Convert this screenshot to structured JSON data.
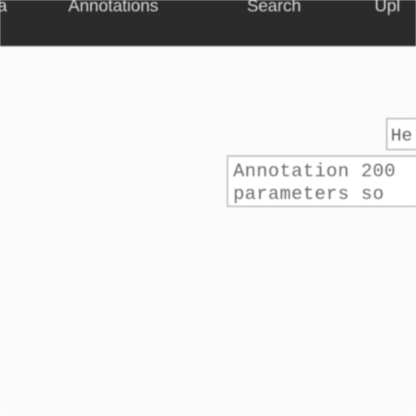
{
  "navbar": {
    "items": [
      {
        "label": "a"
      },
      {
        "label": "Annotations"
      },
      {
        "label": "Search"
      },
      {
        "label": "Upl"
      }
    ]
  },
  "main": {
    "small_field": {
      "text": "He"
    },
    "annotation": {
      "lines": [
        "Annotation 200",
        "parameters so"
      ]
    }
  }
}
